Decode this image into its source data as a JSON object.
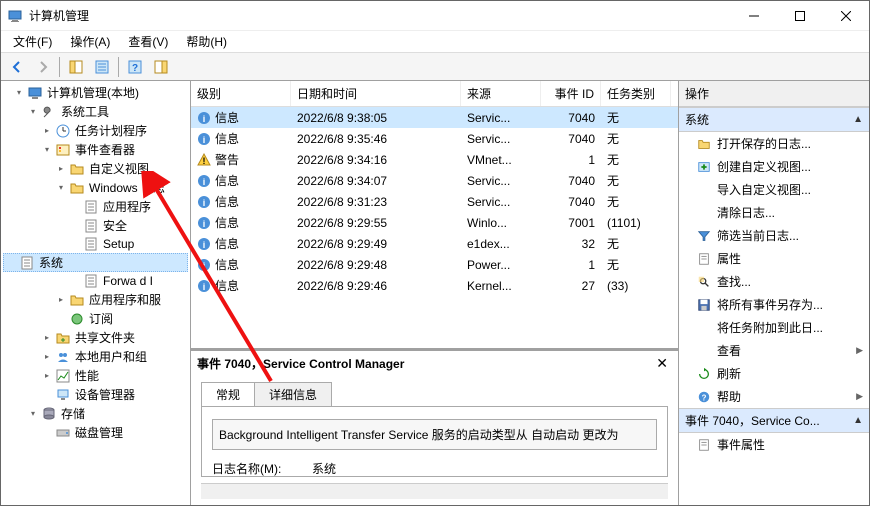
{
  "window": {
    "title": "计算机管理"
  },
  "menus": {
    "file": "文件(F)",
    "action": "操作(A)",
    "view": "查看(V)",
    "help": "帮助(H)"
  },
  "tree": [
    {
      "label": "计算机管理(本地)",
      "indent": 1,
      "toggle": "open",
      "icon": "computer"
    },
    {
      "label": "系统工具",
      "indent": 2,
      "toggle": "open",
      "icon": "wrench"
    },
    {
      "label": "任务计划程序",
      "indent": 3,
      "toggle": "closed",
      "icon": "schedule"
    },
    {
      "label": "事件查看器",
      "indent": 3,
      "toggle": "open",
      "icon": "eventviewer"
    },
    {
      "label": "自定义视图",
      "indent": 4,
      "toggle": "closed",
      "icon": "folder"
    },
    {
      "label": "Windows 日志",
      "indent": 4,
      "toggle": "open",
      "icon": "folder"
    },
    {
      "label": "应用程序",
      "indent": 5,
      "toggle": "none",
      "icon": "log"
    },
    {
      "label": "安全",
      "indent": 5,
      "toggle": "none",
      "icon": "log"
    },
    {
      "label": "Setup",
      "indent": 5,
      "toggle": "none",
      "icon": "log"
    },
    {
      "label": "系统",
      "indent": 5,
      "toggle": "none",
      "icon": "log",
      "selected": true
    },
    {
      "label": "Forwa    d I",
      "indent": 5,
      "toggle": "none",
      "icon": "log"
    },
    {
      "label": "应用程序和服   ",
      "indent": 4,
      "toggle": "closed",
      "icon": "folder"
    },
    {
      "label": "订阅",
      "indent": 4,
      "toggle": "none",
      "icon": "subscribe"
    },
    {
      "label": "共享文件夹",
      "indent": 3,
      "toggle": "closed",
      "icon": "share"
    },
    {
      "label": "本地用户和组",
      "indent": 3,
      "toggle": "closed",
      "icon": "users"
    },
    {
      "label": "性能",
      "indent": 3,
      "toggle": "closed",
      "icon": "perf"
    },
    {
      "label": "设备管理器",
      "indent": 3,
      "toggle": "none",
      "icon": "device"
    },
    {
      "label": "存储",
      "indent": 2,
      "toggle": "open",
      "icon": "storage"
    },
    {
      "label": "磁盘管理",
      "indent": 3,
      "toggle": "none",
      "icon": "disk"
    }
  ],
  "columns": {
    "level": "级别",
    "date": "日期和时间",
    "source": "来源",
    "id": "事件 ID",
    "category": "任务类别"
  },
  "events": [
    {
      "level": "信息",
      "icon": "info",
      "date": "2022/6/8 9:38:05",
      "source": "Servic...",
      "id": "7040",
      "cat": "无",
      "selected": true
    },
    {
      "level": "信息",
      "icon": "info",
      "date": "2022/6/8 9:35:46",
      "source": "Servic...",
      "id": "7040",
      "cat": "无"
    },
    {
      "level": "警告",
      "icon": "warn",
      "date": "2022/6/8 9:34:16",
      "source": "VMnet...",
      "id": "1",
      "cat": "无"
    },
    {
      "level": "信息",
      "icon": "info",
      "date": "2022/6/8 9:34:07",
      "source": "Servic...",
      "id": "7040",
      "cat": "无"
    },
    {
      "level": "信息",
      "icon": "info",
      "date": "2022/6/8 9:31:23",
      "source": "Servic...",
      "id": "7040",
      "cat": "无"
    },
    {
      "level": "信息",
      "icon": "info",
      "date": "2022/6/8 9:29:55",
      "source": "Winlo...",
      "id": "7001",
      "cat": "(1101)"
    },
    {
      "level": "信息",
      "icon": "info",
      "date": "2022/6/8 9:29:49",
      "source": "e1dex...",
      "id": "32",
      "cat": "无"
    },
    {
      "level": "信息",
      "icon": "info",
      "date": "2022/6/8 9:29:48",
      "source": "Power...",
      "id": "1",
      "cat": "无"
    },
    {
      "level": "信息",
      "icon": "info",
      "date": "2022/6/8 9:29:46",
      "source": "Kernel...",
      "id": "27",
      "cat": "(33)"
    }
  ],
  "detail": {
    "header": "事件 7040，Service Control Manager",
    "tabs": {
      "general": "常规",
      "details": "详细信息"
    },
    "message": "Background Intelligent Transfer Service 服务的启动类型从 自动启动 更改为",
    "logname_label": "日志名称(M):",
    "logname_value": "系统"
  },
  "actions": {
    "header": "操作",
    "group1": "系统",
    "items1": [
      {
        "label": "打开保存的日志...",
        "icon": "folderopen"
      },
      {
        "label": "创建自定义视图...",
        "icon": "customview"
      },
      {
        "label": "导入自定义视图...",
        "icon": "blank"
      },
      {
        "label": "清除日志...",
        "icon": "blank"
      },
      {
        "label": "筛选当前日志...",
        "icon": "filter"
      },
      {
        "label": "属性",
        "icon": "props"
      },
      {
        "label": "查找...",
        "icon": "find"
      },
      {
        "label": "将所有事件另存为...",
        "icon": "save"
      },
      {
        "label": "将任务附加到此日...",
        "icon": "blank"
      },
      {
        "label": "查看",
        "icon": "blank",
        "arrow": true
      },
      {
        "label": "刷新",
        "icon": "refresh"
      },
      {
        "label": "帮助",
        "icon": "help",
        "arrow": true
      }
    ],
    "group2": "事件 7040，Service Co...",
    "items2": [
      {
        "label": "事件属性",
        "icon": "props"
      }
    ]
  }
}
